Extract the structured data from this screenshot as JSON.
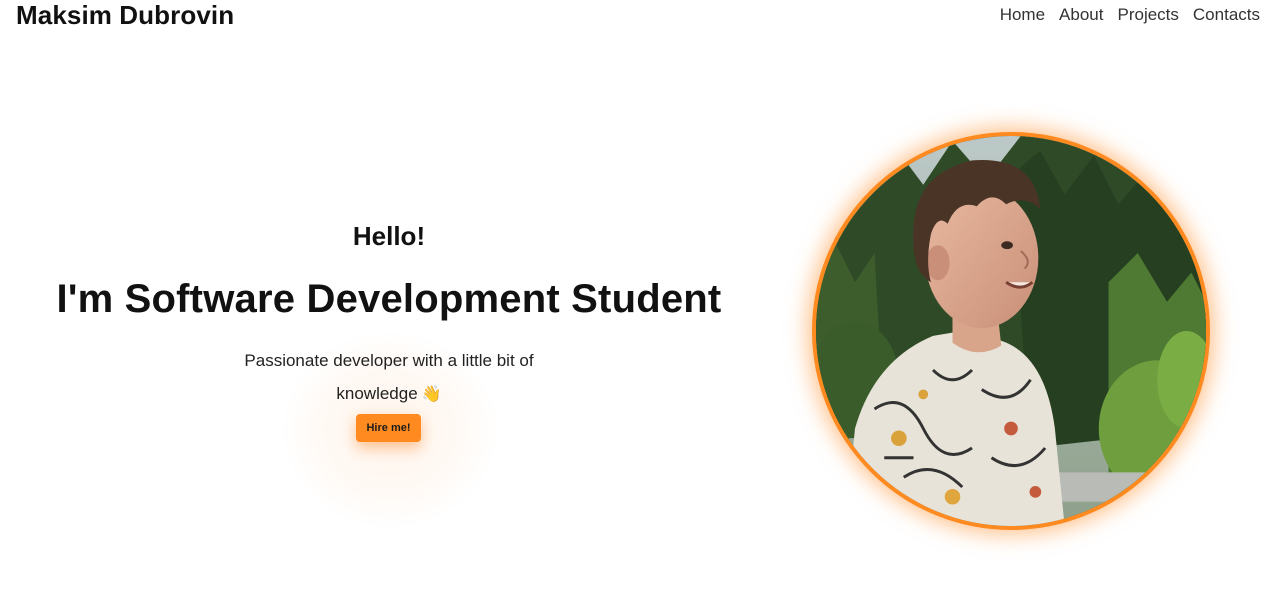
{
  "header": {
    "brand": "Maksim Dubrovin",
    "nav": [
      {
        "label": "Home"
      },
      {
        "label": "About"
      },
      {
        "label": "Projects"
      },
      {
        "label": "Contacts"
      }
    ]
  },
  "hero": {
    "greeting": "Hello!",
    "headline": "I'm Software Development Student",
    "tagline": "Passionate developer with a little bit of knowledge",
    "tagline_emoji": "👋",
    "cta_label": "Hire me!"
  },
  "colors": {
    "accent": "#ff8a1f",
    "text": "#111111",
    "background": "#ffffff"
  },
  "icons": {
    "wave": "waving-hand-icon"
  }
}
